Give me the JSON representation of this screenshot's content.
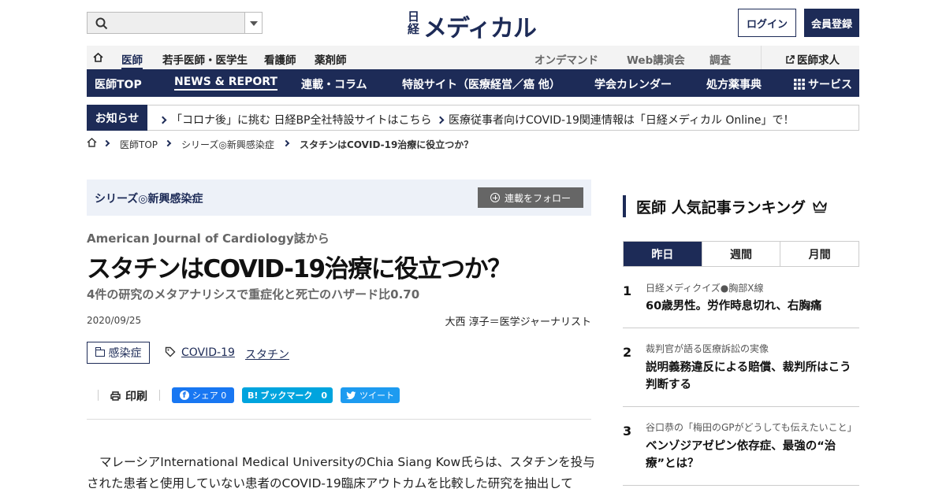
{
  "header": {
    "logo_top": "日経",
    "logo_main": "メディカル",
    "login_label": "ログイン",
    "register_label": "会員登録"
  },
  "subnav": {
    "items": [
      "医師",
      "若手医師・医学生",
      "看護師",
      "薬剤師"
    ],
    "right_items": [
      "オンデマンド",
      "Web講演会",
      "調査"
    ],
    "jobs_label": "医師求人"
  },
  "mainnav": {
    "items": [
      "医師TOP",
      "NEWS & REPORT",
      "連載・コラム",
      "特設サイト（医療経営／癌 他）",
      "学会カレンダー",
      "処方薬事典",
      "サービス"
    ]
  },
  "notice": {
    "label": "お知らせ",
    "links": [
      "「コロナ後」に挑む 日経BP全社特設サイトはこちら",
      "医療従事者向けCOVID-19関連情報は「日経メディカル Online」で！"
    ]
  },
  "breadcrumb": [
    "医師TOP",
    "シリーズ◎新興感染症",
    "スタチンはCOVID-19治療に役立つか？"
  ],
  "article": {
    "series_name": "シリーズ◎新興感染症",
    "follow_label": "連載をフォロー",
    "kicker": "American Journal of Cardiology誌から",
    "headline": "スタチンはCOVID-19治療に役立つか？",
    "subhead": "4件の研究のメタアナリシスで重症化と死亡のハザード比0.70",
    "date": "2020/09/25",
    "author": "大西 淳子＝医学ジャーナリスト",
    "category": "感染症",
    "tags": [
      "COVID-19",
      "スタチン"
    ],
    "print_label": "印刷",
    "share_fb": "シェア 0",
    "share_hb": "ブックマーク　0",
    "share_tw": "ツイート",
    "body": "マレーシアInternational Medical UniversityのChia Siang Kow氏らは、スタチンを投与された患者と使用していない患者のCOVID-19臨床アウトカムを比較した研究を抽出して"
  },
  "ranking": {
    "title": "医師 人気記事ランキング",
    "tabs": [
      "昨日",
      "週間",
      "月間"
    ],
    "items": [
      {
        "rank": "1",
        "category": "日経メディクイズ●胸部X線",
        "title": "60歳男性。労作時息切れ、右胸痛"
      },
      {
        "rank": "2",
        "category": "裁判官が語る医療訴訟の実像",
        "title": "説明義務違反による賠償、裁判所はこう判断する"
      },
      {
        "rank": "3",
        "category": "谷口恭の「梅田のGPがどうしても伝えたいこと」",
        "title": "ベンゾジアゼピン依存症、最強の“治療”とは？"
      }
    ]
  },
  "colors": {
    "brand_navy": "#1d2b57",
    "facebook": "#1877f2",
    "hatena": "#00a4de",
    "twitter": "#1d9bf0"
  }
}
